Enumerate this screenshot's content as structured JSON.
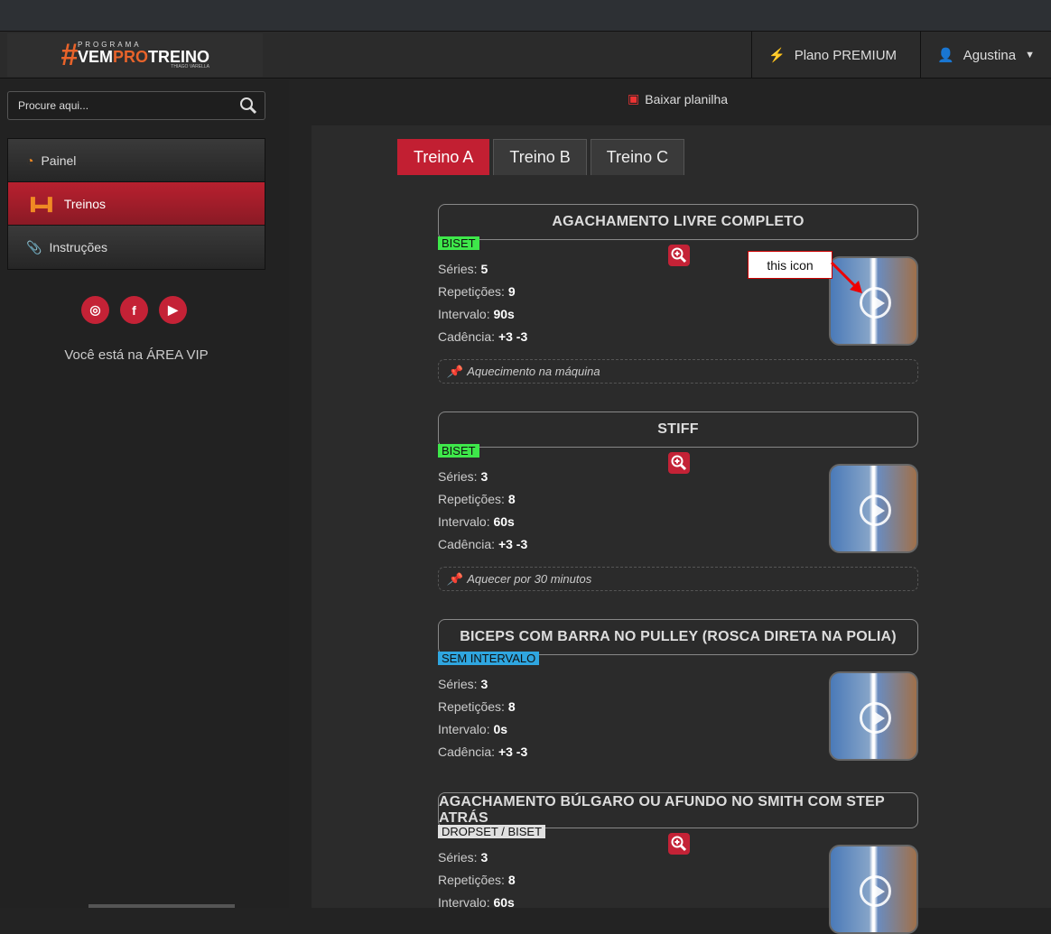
{
  "header": {
    "logo_top": "PROGRAMA",
    "logo_a": "VEM",
    "logo_b": "PRO",
    "logo_c": "TREINO",
    "logo_sig": "THIAGO VARELLA",
    "plan": "Plano PREMIUM",
    "user": "Agustina"
  },
  "sidebar": {
    "search_placeholder": "Procure aqui...",
    "items": [
      {
        "label": "Painel"
      },
      {
        "label": "Treinos"
      },
      {
        "label": "Instruções"
      }
    ],
    "vip": "Você está na ÁREA VIP"
  },
  "download": "Baixar planilha",
  "tabs": [
    "Treino A",
    "Treino B",
    "Treino C"
  ],
  "labels": {
    "series": "Séries:",
    "reps": "Repetições:",
    "interval": "Intervalo:",
    "cadence": "Cadência:"
  },
  "callout": "this icon",
  "exercises": [
    {
      "title": "AGACHAMENTO LIVRE COMPLETO",
      "badge": "BISET",
      "badge_color": "#3ee84a",
      "series": "5",
      "reps": "9",
      "interval": "90s",
      "cadence": "+3 -3",
      "note": "Aquecimento na máquina"
    },
    {
      "title": "STIFF",
      "badge": "BISET",
      "badge_color": "#3ee84a",
      "series": "3",
      "reps": "8",
      "interval": "60s",
      "cadence": "+3 -3",
      "note": "Aquecer por 30 minutos"
    },
    {
      "title": "BICEPS COM BARRA NO PULLEY (ROSCA DIRETA NA POLIA)",
      "badge": "SEM INTERVALO",
      "badge_color": "#2fa6e0",
      "series": "3",
      "reps": "8",
      "interval": "0s",
      "cadence": "+3 -3"
    },
    {
      "title": "AGACHAMENTO BÚLGARO OU AFUNDO NO SMITH COM STEP ATRÁS",
      "badge": "DROPSET / BISET",
      "badge_color": "#e0e0e0",
      "series": "3",
      "reps": "8",
      "interval": "60s"
    }
  ]
}
